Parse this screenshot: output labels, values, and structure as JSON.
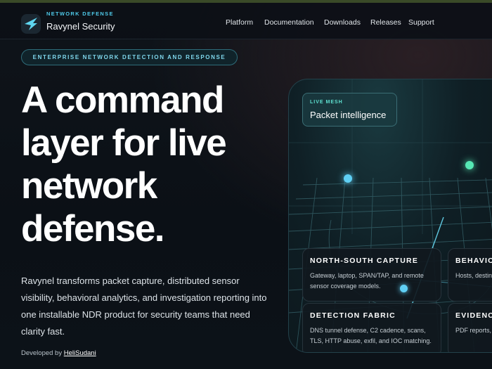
{
  "brand": {
    "eyebrow": "NETWORK DEFENSE",
    "name": "Ravynel Security",
    "logo_icon": "bird-wing-icon"
  },
  "nav": {
    "items": [
      {
        "label": "Platform"
      },
      {
        "label": "Documentation"
      },
      {
        "label": "Downloads"
      },
      {
        "label": "Releases"
      },
      {
        "label": "Support"
      }
    ]
  },
  "hero": {
    "pill": "ENTERPRISE NETWORK DETECTION AND RESPONSE",
    "title": "A command layer for live network defense.",
    "description": "Ravynel transforms packet capture, distributed sensor visibility, behavioral analytics, and investigation reporting into one installable NDR product for security teams that need clarity fast.",
    "credit_prefix": "Developed by",
    "credit_name": "HeliSudani"
  },
  "mesh": {
    "eyebrow": "LIVE MESH",
    "title": "Packet intelligence",
    "cards": [
      {
        "title": "NORTH-SOUTH CAPTURE",
        "desc": "Gateway, laptop, SPAN/TAP, and remote sensor coverage models."
      },
      {
        "title": "BEHAVIOR",
        "desc": "Hosts, destinations, sessions, and"
      },
      {
        "title": "DETECTION FABRIC",
        "desc": "DNS tunnel defense, C2 cadence, scans, TLS, HTTP abuse, exfil, and IOC matching."
      },
      {
        "title": "EVIDENCE",
        "desc": "PDF reports, context, and"
      }
    ]
  },
  "colors": {
    "accent_cyan": "#4ec9e8",
    "accent_green": "#4ee0b0",
    "background": "#0c1218"
  }
}
